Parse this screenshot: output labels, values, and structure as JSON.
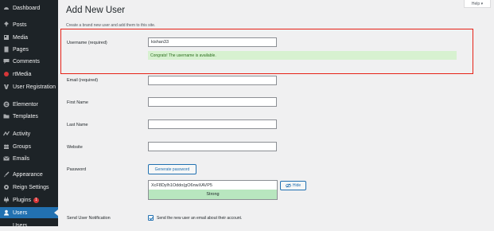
{
  "sidebar": {
    "items": [
      {
        "label": "Dashboard",
        "icon": "dashboard-icon"
      },
      {
        "label": "Posts",
        "icon": "pin-icon"
      },
      {
        "label": "Media",
        "icon": "media-icon"
      },
      {
        "label": "Pages",
        "icon": "page-icon"
      },
      {
        "label": "Comments",
        "icon": "comment-icon"
      },
      {
        "label": "rtMedia",
        "icon": "rtmedia-icon"
      },
      {
        "label": "User Registration",
        "icon": "user-registration-icon"
      },
      {
        "label": "Elementor",
        "icon": "elementor-icon"
      },
      {
        "label": "Templates",
        "icon": "folder-icon"
      },
      {
        "label": "Activity",
        "icon": "activity-icon"
      },
      {
        "label": "Groups",
        "icon": "groups-icon"
      },
      {
        "label": "Emails",
        "icon": "email-icon"
      },
      {
        "label": "Appearance",
        "icon": "brush-icon"
      },
      {
        "label": "Reign Settings",
        "icon": "settings-icon"
      },
      {
        "label": "Plugins",
        "icon": "plugin-icon",
        "badge": "1"
      },
      {
        "label": "Users",
        "icon": "users-icon",
        "active": true
      },
      {
        "label": "Users",
        "icon": "users-icon"
      }
    ]
  },
  "header": {
    "title": "Add New User",
    "subtitle": "Create a brand new user and add them to this site.",
    "help_label": "Help ▾"
  },
  "form": {
    "username": {
      "label": "Username (required)",
      "value": "kishan33",
      "notice": "Congrats! The username is available."
    },
    "email": {
      "label": "Email (required)",
      "value": ""
    },
    "first_name": {
      "label": "First Name",
      "value": ""
    },
    "last_name": {
      "label": "Last Name",
      "value": ""
    },
    "website": {
      "label": "Website",
      "value": ""
    },
    "password": {
      "label": "Password",
      "generate_label": "Generate password",
      "value": "XcF8Dylh1Oddo(gO6nwXAVP5",
      "hide_label": "Hide",
      "strength": "Strong"
    },
    "notification": {
      "label": "Send User Notification",
      "text": "Send the new user an email about their account.",
      "checked": true
    }
  },
  "colors": {
    "sidebar_bg": "#1d2327",
    "active_bg": "#2271b1",
    "highlight_border": "#e62117",
    "notice_bg": "#d7f1d0",
    "strength_bg": "#b8e6bf"
  }
}
